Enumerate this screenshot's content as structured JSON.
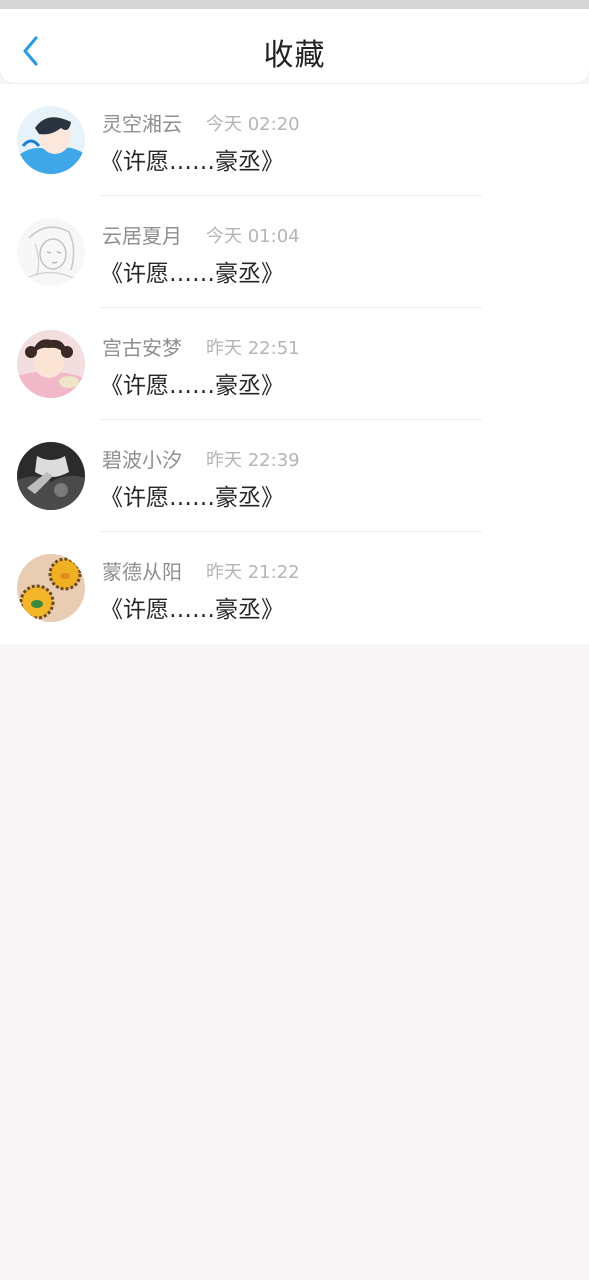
{
  "header": {
    "title": "收藏",
    "back_icon": "chevron-left-icon",
    "accent_color": "#2e9ae0"
  },
  "favorites": [
    {
      "name": "灵空湘云",
      "time": "今天 02:20",
      "snippet": "《许愿……豪丞》",
      "avatar": "anime-boy-blue-avatar"
    },
    {
      "name": "云居夏月",
      "time": "今天 01:04",
      "snippet": "《许愿……豪丞》",
      "avatar": "sketch-girl-avatar"
    },
    {
      "name": "宫古安梦",
      "time": "昨天 22:51",
      "snippet": "《许愿……豪丞》",
      "avatar": "child-photo-avatar"
    },
    {
      "name": "碧波小汐",
      "time": "昨天 22:39",
      "snippet": "《许愿……豪丞》",
      "avatar": "monochrome-photo-avatar"
    },
    {
      "name": "蒙德从阳",
      "time": "昨天 21:22",
      "snippet": "《许愿……豪丞》",
      "avatar": "pastry-photo-avatar"
    }
  ]
}
